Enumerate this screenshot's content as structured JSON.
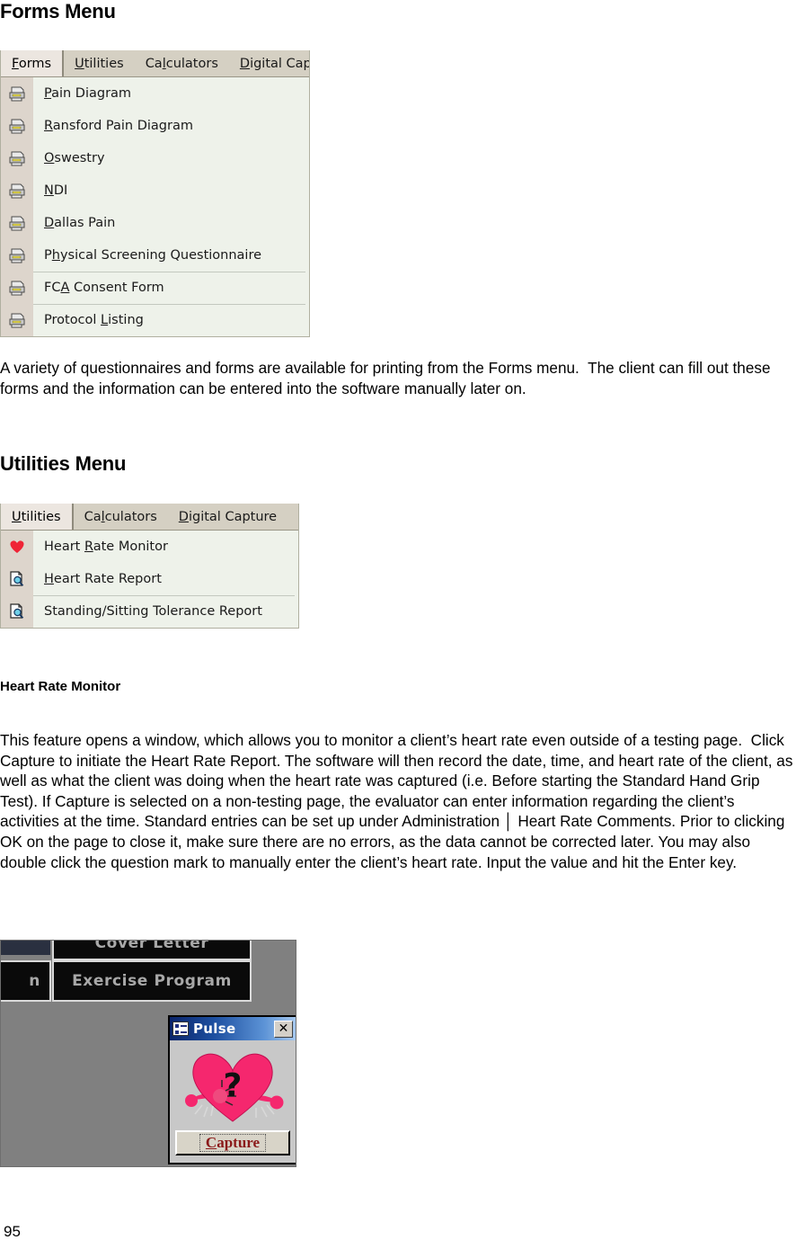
{
  "document": {
    "page_number": "95"
  },
  "forms_section": {
    "heading": "Forms Menu",
    "menubar": {
      "tabs": [
        {
          "label": "Forms",
          "accel": "F",
          "active": true
        },
        {
          "label": "Utilities",
          "accel": "U",
          "active": false
        },
        {
          "label": "Calculators",
          "accel": "l",
          "active": false
        },
        {
          "label": "Digital Capt",
          "accel": "D",
          "active": false
        }
      ]
    },
    "items": [
      {
        "label": "Pain Diagram",
        "icon": "printer-icon",
        "separator_above": false
      },
      {
        "label": "Ransford Pain Diagram",
        "icon": "printer-icon",
        "separator_above": false
      },
      {
        "label": "Oswestry",
        "icon": "printer-icon",
        "separator_above": false
      },
      {
        "label": "NDI",
        "icon": "printer-icon",
        "separator_above": false
      },
      {
        "label": "Dallas Pain",
        "icon": "printer-icon",
        "separator_above": false
      },
      {
        "label": "Physical Screening Questionnaire",
        "icon": "printer-icon",
        "separator_above": false
      },
      {
        "label": "FCA Consent Form",
        "icon": "printer-icon",
        "separator_above": true
      },
      {
        "label": "Protocol Listing",
        "icon": "printer-icon",
        "separator_above": true
      }
    ],
    "paragraph": "A variety of questionnaires and forms are available for printing from the Forms menu.  The client can fill out these forms and the information can be entered into the software manually later on."
  },
  "utilities_section": {
    "heading": "Utilities Menu",
    "menubar": {
      "tabs": [
        {
          "label": "Utilities",
          "accel": "U",
          "active": true
        },
        {
          "label": "Calculators",
          "accel": "l",
          "active": false
        },
        {
          "label": "Digital Capture",
          "accel": "D",
          "active": false
        }
      ]
    },
    "items": [
      {
        "label": "Heart Rate Monitor",
        "icon": "heart-icon",
        "separator_above": false
      },
      {
        "label": "Heart Rate Report",
        "icon": "report-search-icon",
        "separator_above": false
      },
      {
        "label": "Standing/Sitting Tolerance Report",
        "icon": "report-search-icon",
        "separator_above": true
      }
    ],
    "subheading": "Heart Rate Monitor",
    "paragraph": "This feature opens a window, which allows you to monitor a client’s heart rate even outside of a testing page.  Click Capture to initiate the Heart Rate Report. The software will then record the date, time, and heart rate of the client, as well as what the client was doing when the heart rate was captured (i.e. Before starting the Standard Hand Grip Test). If Capture is selected on a non-testing page, the evaluator can enter information regarding the client’s activities at the time. Standard entries can be set up under Administration │ Heart Rate Comments. Prior to clicking OK on the page to close it, make sure there are no errors, as the data cannot be corrected later. You may also double click the question mark to manually enter the client’s heart rate. Input the value and hit the Enter key."
  },
  "app_screenshot": {
    "background_color": "#808080",
    "buttons": [
      {
        "label": "Cover Letter",
        "name": "cover-letter-button"
      },
      {
        "label": "Exercise Program",
        "name": "exercise-program-button"
      },
      {
        "label": "n",
        "name": "partial-left-button"
      }
    ],
    "pulse_dialog": {
      "title": "Pulse",
      "close_label": "✕",
      "capture_label": "Capture",
      "capture_accel": "C",
      "heart_color": "#f5276e",
      "question_mark": "?",
      "titlebar_color": "#0a246a"
    }
  }
}
